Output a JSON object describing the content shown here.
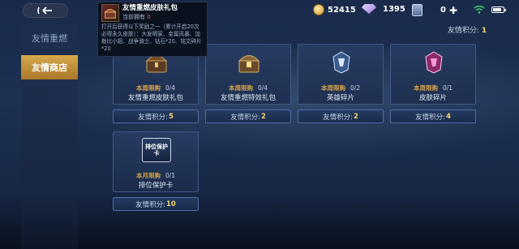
{
  "status": {
    "coins": "52415",
    "gems": "1395",
    "tickets": "0",
    "battery_level": 0.8
  },
  "header": {
    "points_label": "友情积分:",
    "points_value": "1"
  },
  "sidebar": {
    "items": [
      {
        "label": "友情重燃"
      },
      {
        "label": "友情商店"
      }
    ]
  },
  "tooltip": {
    "title": "友情重燃皮肤礼包",
    "owned_label": "当前拥有",
    "owned_value": "0",
    "description": "打开后获得以下奖励之一（累计开启20次必得永久皮肤）：大发明家、金属风暴、加勒比小姐、战争骑士、钻石*20、铭文碎片*20"
  },
  "cards": [
    {
      "limit_label": "本周限购",
      "limit_value": "0/4",
      "name": "友情重燃皮肤礼包",
      "price_label": "友情积分:",
      "price": "5"
    },
    {
      "limit_label": "本周限购",
      "limit_value": "0/4",
      "name": "友情重燃特效礼包",
      "price_label": "友情积分:",
      "price": "2"
    },
    {
      "limit_label": "本周限购",
      "limit_value": "0/2",
      "name": "英雄碎片",
      "price_label": "友情积分:",
      "price": "2"
    },
    {
      "limit_label": "本周限购",
      "limit_value": "0/1",
      "name": "皮肤碎片",
      "price_label": "友情积分:",
      "price": "4"
    },
    {
      "limit_label": "本月限购",
      "limit_value": "0/1",
      "name": "排位保护卡",
      "price_label": "友情积分:",
      "price": "10",
      "icon_text": "排位保护卡"
    }
  ],
  "colors": {
    "accent_gold": "#f1d36a",
    "limit_orange": "#d8a24a",
    "active_tab": "#c9963c"
  }
}
